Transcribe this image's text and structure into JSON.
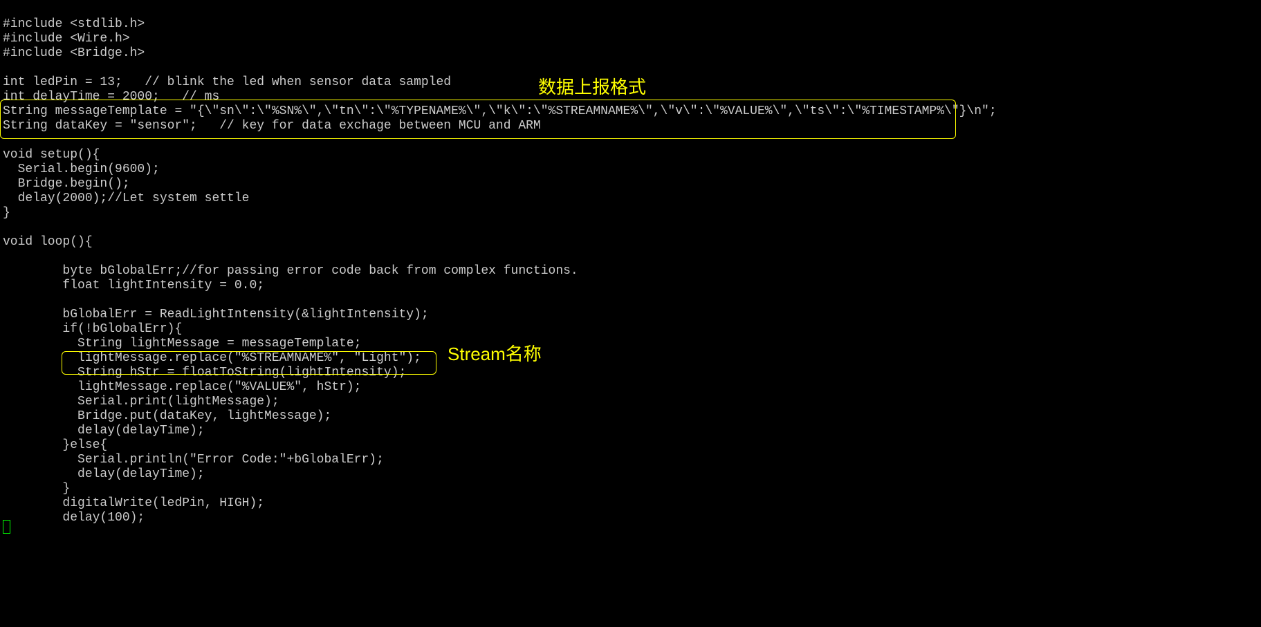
{
  "annotations": {
    "top_label": "数据上报格式",
    "mid_label": "Stream名称"
  },
  "code": {
    "l1": "#include <stdlib.h>",
    "l2": "#include <Wire.h>",
    "l3": "#include <Bridge.h>",
    "l4": "",
    "l5": "int ledPin = 13;   // blink the led when sensor data sampled",
    "l6": "int delayTime = 2000;   // ms",
    "l7": "String messageTemplate = \"{\\\"sn\\\":\\\"%SN%\\\",\\\"tn\\\":\\\"%TYPENAME%\\\",\\\"k\\\":\\\"%STREAMNAME%\\\",\\\"v\\\":\\\"%VALUE%\\\",\\\"ts\\\":\\\"%TIMESTAMP%\\\"}\\n\";",
    "l8": "String dataKey = \"sensor\";   // key for data exchage between MCU and ARM",
    "l9": "",
    "l10": "void setup(){",
    "l11": "  Serial.begin(9600);",
    "l12": "  Bridge.begin();",
    "l13": "  delay(2000);//Let system settle",
    "l14": "}",
    "l15": "",
    "l16": "void loop(){",
    "l17": "",
    "l18": "        byte bGlobalErr;//for passing error code back from complex functions.",
    "l19": "        float lightIntensity = 0.0;",
    "l20": "",
    "l21": "        bGlobalErr = ReadLightIntensity(&lightIntensity);",
    "l22": "        if(!bGlobalErr){",
    "l23": "          String lightMessage = messageTemplate;",
    "l24": "          lightMessage.replace(\"%STREAMNAME%\", \"Light\");",
    "l25": "          String hStr = floatToString(lightIntensity);",
    "l26": "          lightMessage.replace(\"%VALUE%\", hStr);",
    "l27": "          Serial.print(lightMessage);",
    "l28": "          Bridge.put(dataKey, lightMessage);",
    "l29": "          delay(delayTime);",
    "l30": "        }else{",
    "l31": "          Serial.println(\"Error Code:\"+bGlobalErr);",
    "l32": "          delay(delayTime);",
    "l33": "        }",
    "l34": "        digitalWrite(ledPin, HIGH);",
    "l35": "        delay(100);"
  }
}
